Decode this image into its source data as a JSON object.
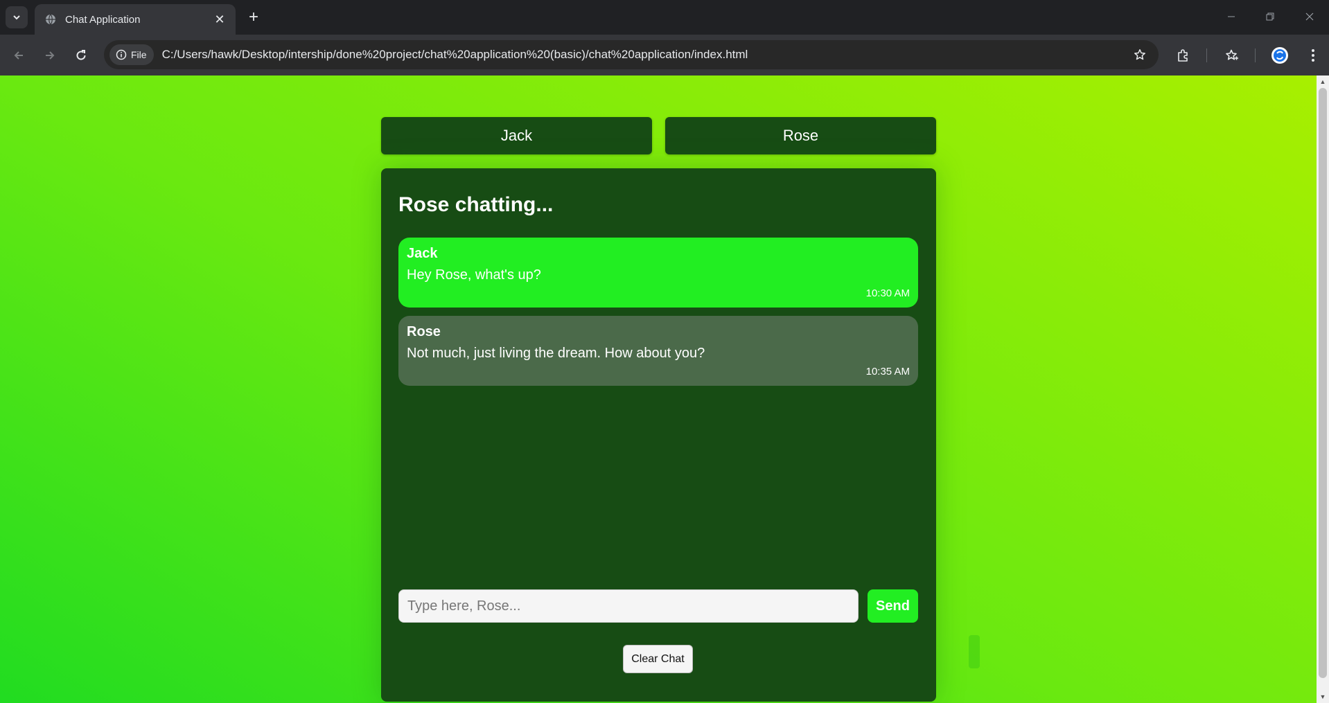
{
  "browser": {
    "tab_title": "Chat Application",
    "new_tab_symbol": "+",
    "site_chip_label": "File",
    "url": "C:/Users/hawk/Desktop/intership/done%20project/chat%20application%20(basic)/chat%20application/index.html"
  },
  "users": {
    "jack_label": "Jack",
    "rose_label": "Rose"
  },
  "chat": {
    "title": "Rose chatting...",
    "messages": [
      {
        "sender": "Jack",
        "text": "Hey Rose, what's up?",
        "time": "10:30 AM"
      },
      {
        "sender": "Rose",
        "text": "Not much, just living the dream. How about you?",
        "time": "10:35 AM"
      }
    ],
    "input_placeholder": "Type here, Rose...",
    "send_label": "Send",
    "clear_label": "Clear Chat"
  },
  "colors": {
    "panel": "#174c14",
    "own_bubble": "#22ee22",
    "other_bubble": "#4b6a4a",
    "send_button": "#22ee22"
  }
}
